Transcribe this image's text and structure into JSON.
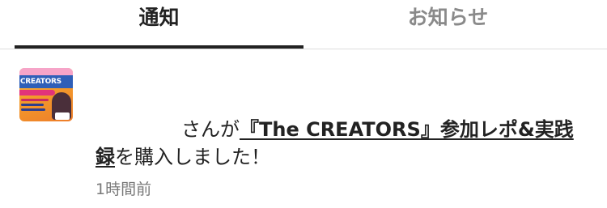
{
  "tabs": [
    {
      "label": "通知",
      "active": true
    },
    {
      "label": "お知らせ",
      "active": false
    }
  ],
  "colors": {
    "active_tab": "#222222",
    "inactive_tab": "#8a8a8a",
    "timestamp": "#7a7a7a",
    "divider": "#dddddd"
  },
  "notification": {
    "thumbnail_text": "CREATORS",
    "user_suffix": "さんが",
    "product_title": "『The CREATORS』参加レポ&実践録",
    "action_text": "を購入しました！",
    "timestamp": "1時間前"
  }
}
